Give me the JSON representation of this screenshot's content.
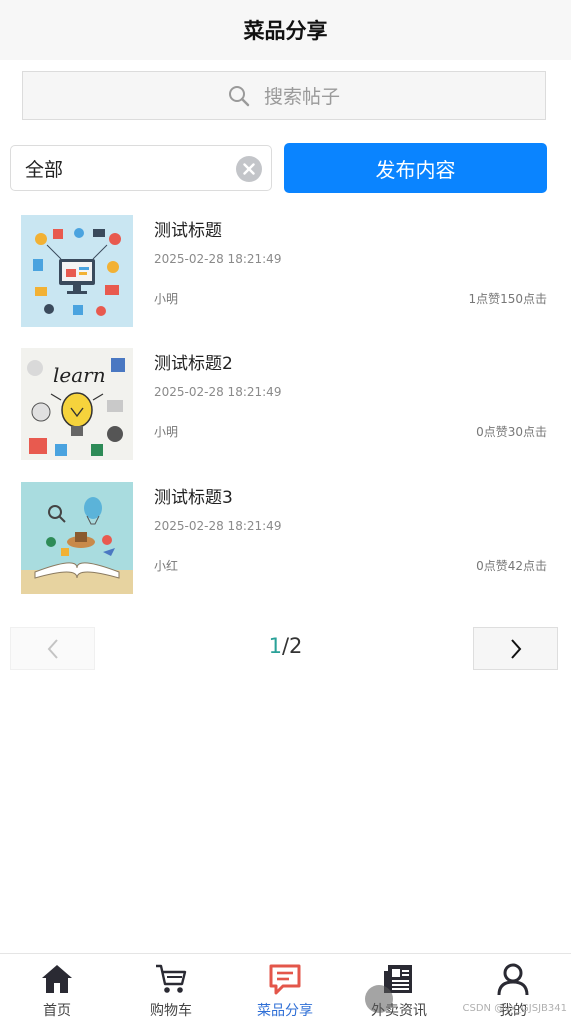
{
  "header": {
    "title": "菜品分享"
  },
  "search": {
    "placeholder": "搜索帖子",
    "icon": "search-icon"
  },
  "filter": {
    "value": "全部",
    "clear_icon": "clear-icon"
  },
  "publish_button": {
    "label": "发布内容"
  },
  "posts": [
    {
      "title": "测试标题",
      "date": "2025-02-28 18:21:49",
      "author": "小明",
      "stats": "1点赞150点击",
      "thumb": "tech-illustration"
    },
    {
      "title": "测试标题2",
      "date": "2025-02-28 18:21:49",
      "author": "小明",
      "stats": "0点赞30点击",
      "thumb": "learn-lightbulb"
    },
    {
      "title": "测试标题3",
      "date": "2025-02-28 18:21:49",
      "author": "小红",
      "stats": "0点赞42点击",
      "thumb": "open-book"
    }
  ],
  "pagination": {
    "current": "1",
    "separator_total": "/2"
  },
  "tabbar": {
    "tabs": [
      {
        "label": "首页",
        "icon": "home-icon",
        "active": false
      },
      {
        "label": "购物车",
        "icon": "cart-icon",
        "active": false
      },
      {
        "label": "菜品分享",
        "icon": "chat-icon",
        "active": true
      },
      {
        "label": "外卖资讯",
        "icon": "news-icon",
        "active": false
      },
      {
        "label": "我的",
        "icon": "user-icon",
        "active": false
      }
    ]
  },
  "watermark": "CSDN @vx_GJSJB341",
  "colors": {
    "accent": "#0a84ff",
    "active_tab": "#2f6fd6",
    "page_current": "#2aa198"
  }
}
